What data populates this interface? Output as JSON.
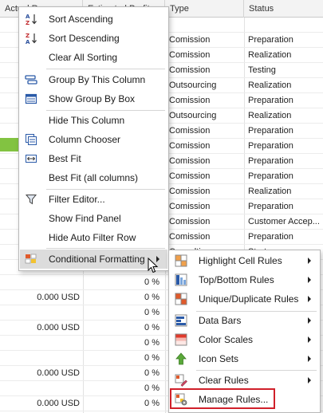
{
  "grid": {
    "columns": [
      "Actual Revenue",
      "Estimated Profit",
      "Type",
      "Status"
    ],
    "rows": [
      {
        "revenue": "",
        "profit": "",
        "type": "",
        "status": ""
      },
      {
        "revenue": "",
        "profit": "",
        "type": "Comission",
        "status": "Preparation"
      },
      {
        "revenue": "",
        "profit": "",
        "type": "Comission",
        "status": "Realization"
      },
      {
        "revenue": "",
        "profit": "",
        "type": "Comission",
        "status": "Testing"
      },
      {
        "revenue": "",
        "profit": "",
        "type": "Outsourcing",
        "status": "Realization"
      },
      {
        "revenue": "",
        "profit": "",
        "type": "Comission",
        "status": "Preparation"
      },
      {
        "revenue": "",
        "profit": "",
        "type": "Outsourcing",
        "status": "Realization"
      },
      {
        "revenue": "",
        "profit": "",
        "type": "Comission",
        "status": "Preparation"
      },
      {
        "revenue": "",
        "profit": "",
        "type": "Comission",
        "status": "Preparation"
      },
      {
        "revenue": "",
        "profit": "",
        "type": "Comission",
        "status": "Preparation"
      },
      {
        "revenue": "",
        "profit": "",
        "type": "Comission",
        "status": "Preparation"
      },
      {
        "revenue": "",
        "profit": "",
        "type": "Comission",
        "status": "Realization"
      },
      {
        "revenue": "",
        "profit": "",
        "type": "Comission",
        "status": "Preparation"
      },
      {
        "revenue": "",
        "profit": "",
        "type": "Comission",
        "status": "Customer Accep..."
      },
      {
        "revenue": "",
        "profit": "",
        "type": "Comission",
        "status": "Preparation"
      },
      {
        "revenue": "",
        "profit": "",
        "type": "Consulting",
        "status": "Start"
      },
      {
        "revenue": "",
        "profit": "",
        "type": "",
        "status": ""
      },
      {
        "revenue": "",
        "profit": "0 %",
        "type": "C",
        "status": ""
      },
      {
        "revenue": "0.000 USD",
        "profit": "0 %",
        "type": "C",
        "status": ""
      },
      {
        "revenue": "",
        "profit": "0 %",
        "type": "C",
        "status": ""
      },
      {
        "revenue": "0.000 USD",
        "profit": "0 %",
        "type": "C",
        "status": ""
      },
      {
        "revenue": "",
        "profit": "0 %",
        "type": "C",
        "status": ""
      },
      {
        "revenue": "",
        "profit": "0 %",
        "type": "C",
        "status": ""
      },
      {
        "revenue": "0.000 USD",
        "profit": "0 %",
        "type": "C",
        "status": ""
      },
      {
        "revenue": "",
        "profit": "0 %",
        "type": "C",
        "status": ""
      },
      {
        "revenue": "0.000 USD",
        "profit": "0 %",
        "type": "C",
        "status": ""
      }
    ]
  },
  "main_menu": {
    "items": [
      {
        "label": "Sort Ascending",
        "icon": "sort-ascending-icon"
      },
      {
        "label": "Sort Descending",
        "icon": "sort-descending-icon"
      },
      {
        "label": "Clear All Sorting",
        "icon": ""
      },
      {
        "label": "Group By This Column",
        "icon": "group-by-icon"
      },
      {
        "label": "Show Group By Box",
        "icon": "group-box-icon"
      },
      {
        "label": "Hide This Column",
        "icon": ""
      },
      {
        "label": "Column Chooser",
        "icon": "column-chooser-icon"
      },
      {
        "label": "Best Fit",
        "icon": "best-fit-icon"
      },
      {
        "label": "Best Fit (all columns)",
        "icon": ""
      },
      {
        "label": "Filter Editor...",
        "icon": "filter-icon"
      },
      {
        "label": "Show Find Panel",
        "icon": ""
      },
      {
        "label": "Hide Auto Filter Row",
        "icon": ""
      },
      {
        "label": "Conditional Formatting",
        "icon": "conditional-formatting-icon"
      }
    ]
  },
  "sub_menu": {
    "items": [
      {
        "label": "Highlight Cell Rules",
        "icon": "highlight-cell-rules-icon"
      },
      {
        "label": "Top/Bottom Rules",
        "icon": "top-bottom-rules-icon"
      },
      {
        "label": "Unique/Duplicate Rules",
        "icon": "unique-duplicate-rules-icon"
      },
      {
        "label": "Data Bars",
        "icon": "data-bars-icon"
      },
      {
        "label": "Color Scales",
        "icon": "color-scales-icon"
      },
      {
        "label": "Icon Sets",
        "icon": "icon-sets-icon"
      },
      {
        "label": "Clear Rules",
        "icon": "clear-rules-icon"
      },
      {
        "label": "Manage Rules...",
        "icon": "manage-rules-icon"
      }
    ]
  },
  "colors": {
    "highlight_box": "#d0202a",
    "menu_hover": "#dcdcdc",
    "green_mark": "#82c341"
  }
}
